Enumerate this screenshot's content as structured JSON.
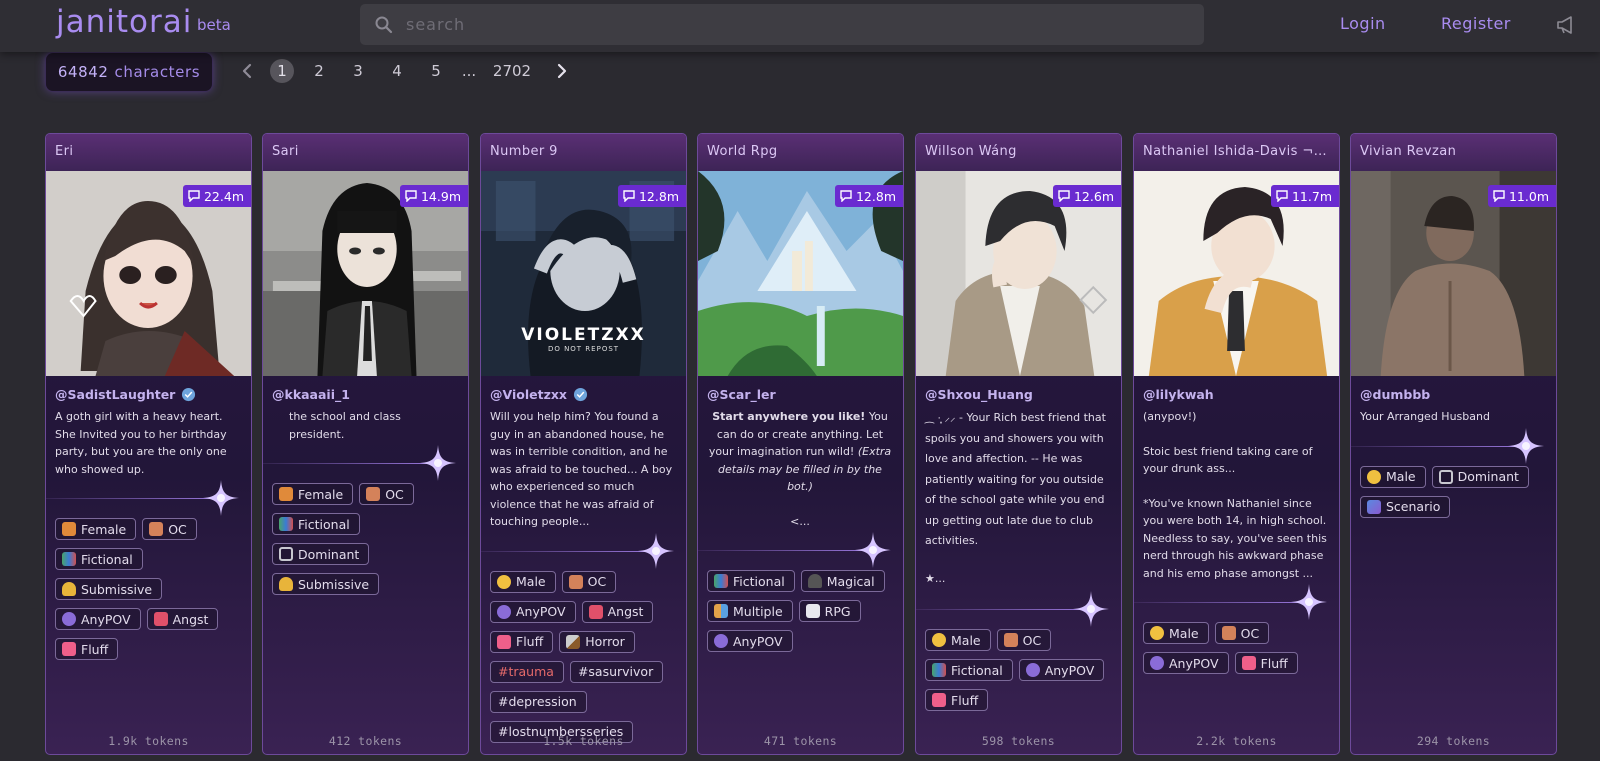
{
  "header": {
    "logo": "janitorai",
    "beta": "beta",
    "search_placeholder": "search",
    "login": "Login",
    "register": "Register"
  },
  "pagination": {
    "count": "64842",
    "count_label": "characters",
    "pages": [
      "1",
      "2",
      "3",
      "4",
      "5"
    ],
    "ellipsis": "...",
    "last": "2702",
    "current": "1"
  },
  "colors": {
    "accent": "#a98cf0",
    "badge": "#6a2bd0",
    "card_border": "#6d4a9a"
  },
  "cards": [
    {
      "name": "Eri",
      "messages": "22.4m",
      "author": "@SadistLaughter",
      "verified": true,
      "desc": [
        "A goth girl with a heavy heart. She Invited you to her birthday party, but you are the only one who showed up."
      ],
      "tags": [
        {
          "label": "Female",
          "icon": "female-icon"
        },
        {
          "label": "OC",
          "icon": "oc-icon"
        },
        {
          "label": "Fictional",
          "icon": "books-icon"
        },
        {
          "label": "Submissive",
          "icon": "bell-icon"
        },
        {
          "label": "AnyPOV",
          "icon": "person-icon"
        },
        {
          "label": "Angst",
          "icon": "broken-heart-icon"
        },
        {
          "label": "Fluff",
          "icon": "heart-icon"
        }
      ],
      "tokens": "1.9k tokens"
    },
    {
      "name": "Sari",
      "messages": "14.9m",
      "author": "@kkaaaii_1",
      "verified": false,
      "desc": [
        "the school and class president."
      ],
      "tags": [
        {
          "label": "Female",
          "icon": "female-icon"
        },
        {
          "label": "OC",
          "icon": "oc-icon"
        },
        {
          "label": "Fictional",
          "icon": "books-icon"
        },
        {
          "label": "Dominant",
          "icon": "chains-icon"
        },
        {
          "label": "Submissive",
          "icon": "bell-icon"
        }
      ],
      "tokens": "412 tokens"
    },
    {
      "name": "Number 9",
      "messages": "12.8m",
      "author": "@Violetzxx",
      "verified": true,
      "desc": [
        "Will you help him? You found a guy in an abandoned house, he was in terrible condition, and he was afraid to be touched... A boy who experienced so much violence that he was afraid of touching people..."
      ],
      "tags": [
        {
          "label": "Male",
          "icon": "male-icon"
        },
        {
          "label": "OC",
          "icon": "oc-icon"
        },
        {
          "label": "AnyPOV",
          "icon": "person-icon"
        },
        {
          "label": "Angst",
          "icon": "broken-heart-icon"
        },
        {
          "label": "Fluff",
          "icon": "heart-icon"
        },
        {
          "label": "Horror",
          "icon": "knife-icon"
        },
        {
          "label": "#trauma",
          "icon": "",
          "hash": "red"
        },
        {
          "label": "#sasurvivor",
          "icon": "",
          "hash": "plain"
        },
        {
          "label": "#depression",
          "icon": "",
          "hash": "plain"
        },
        {
          "label": "#lostnumbersseries",
          "icon": "",
          "hash": "plain"
        }
      ],
      "image_watermark": "VIOLETZXX",
      "image_watermark_sub": "DO NOT REPOST",
      "tokens": "1.5k tokens"
    },
    {
      "name": "World Rpg",
      "messages": "12.8m",
      "author": "@Scar_ler",
      "verified": false,
      "desc_center": true,
      "desc_parts": {
        "bold": "Start anywhere you like!",
        "normal": " You can do or create anything. Let your imagination run wild! ",
        "italic": "(Extra details may be filled in by the bot.)",
        "after": "<..."
      },
      "tags": [
        {
          "label": "Fictional",
          "icon": "books-icon"
        },
        {
          "label": "Magical",
          "icon": "magic-icon"
        },
        {
          "label": "Multiple",
          "icon": "people-icon"
        },
        {
          "label": "RPG",
          "icon": "dice-icon"
        },
        {
          "label": "AnyPOV",
          "icon": "person-icon"
        }
      ],
      "tokens": "471 tokens"
    },
    {
      "name": "Willson Wáng",
      "messages": "12.6m",
      "author": "@Shxou_Huang",
      "verified": false,
      "desc": [
        "⁔ ·̩͙ ⸝⸝ - Your Rich best friend that spoils you and showers you with love and affection. -- He was patiently waiting for you outside of the school gate while you end up getting out late due to club activities.",
        "★..."
      ],
      "tags": [
        {
          "label": "Male",
          "icon": "male-icon"
        },
        {
          "label": "OC",
          "icon": "oc-icon"
        },
        {
          "label": "Fictional",
          "icon": "books-icon"
        },
        {
          "label": "AnyPOV",
          "icon": "person-icon"
        },
        {
          "label": "Fluff",
          "icon": "heart-icon"
        }
      ],
      "tokens": "598 tokens"
    },
    {
      "name": "Nathaniel Ishida-Davis ¬ ...",
      "messages": "11.7m",
      "author": "@lilykwah",
      "verified": false,
      "desc": [
        "(anypov!)",
        "Stoic best friend taking care of your drunk ass...",
        "*You've known Nathaniel since you were both 14, in high school. Needless to say, you've seen this nerd through his awkward phase and his emo phase amongst ..."
      ],
      "tags": [
        {
          "label": "Male",
          "icon": "male-icon"
        },
        {
          "label": "OC",
          "icon": "oc-icon"
        },
        {
          "label": "AnyPOV",
          "icon": "person-icon"
        },
        {
          "label": "Fluff",
          "icon": "heart-icon"
        }
      ],
      "tokens": "2.2k tokens"
    },
    {
      "name": "Vivian Revzan",
      "messages": "11.0m",
      "author": "@dumbbb",
      "verified": false,
      "desc": [
        "Your Arranged Husband"
      ],
      "tags": [
        {
          "label": "Male",
          "icon": "male-icon"
        },
        {
          "label": "Dominant",
          "icon": "chains-icon"
        },
        {
          "label": "Scenario",
          "icon": "scenario-icon"
        }
      ],
      "tokens": "294 tokens"
    }
  ]
}
